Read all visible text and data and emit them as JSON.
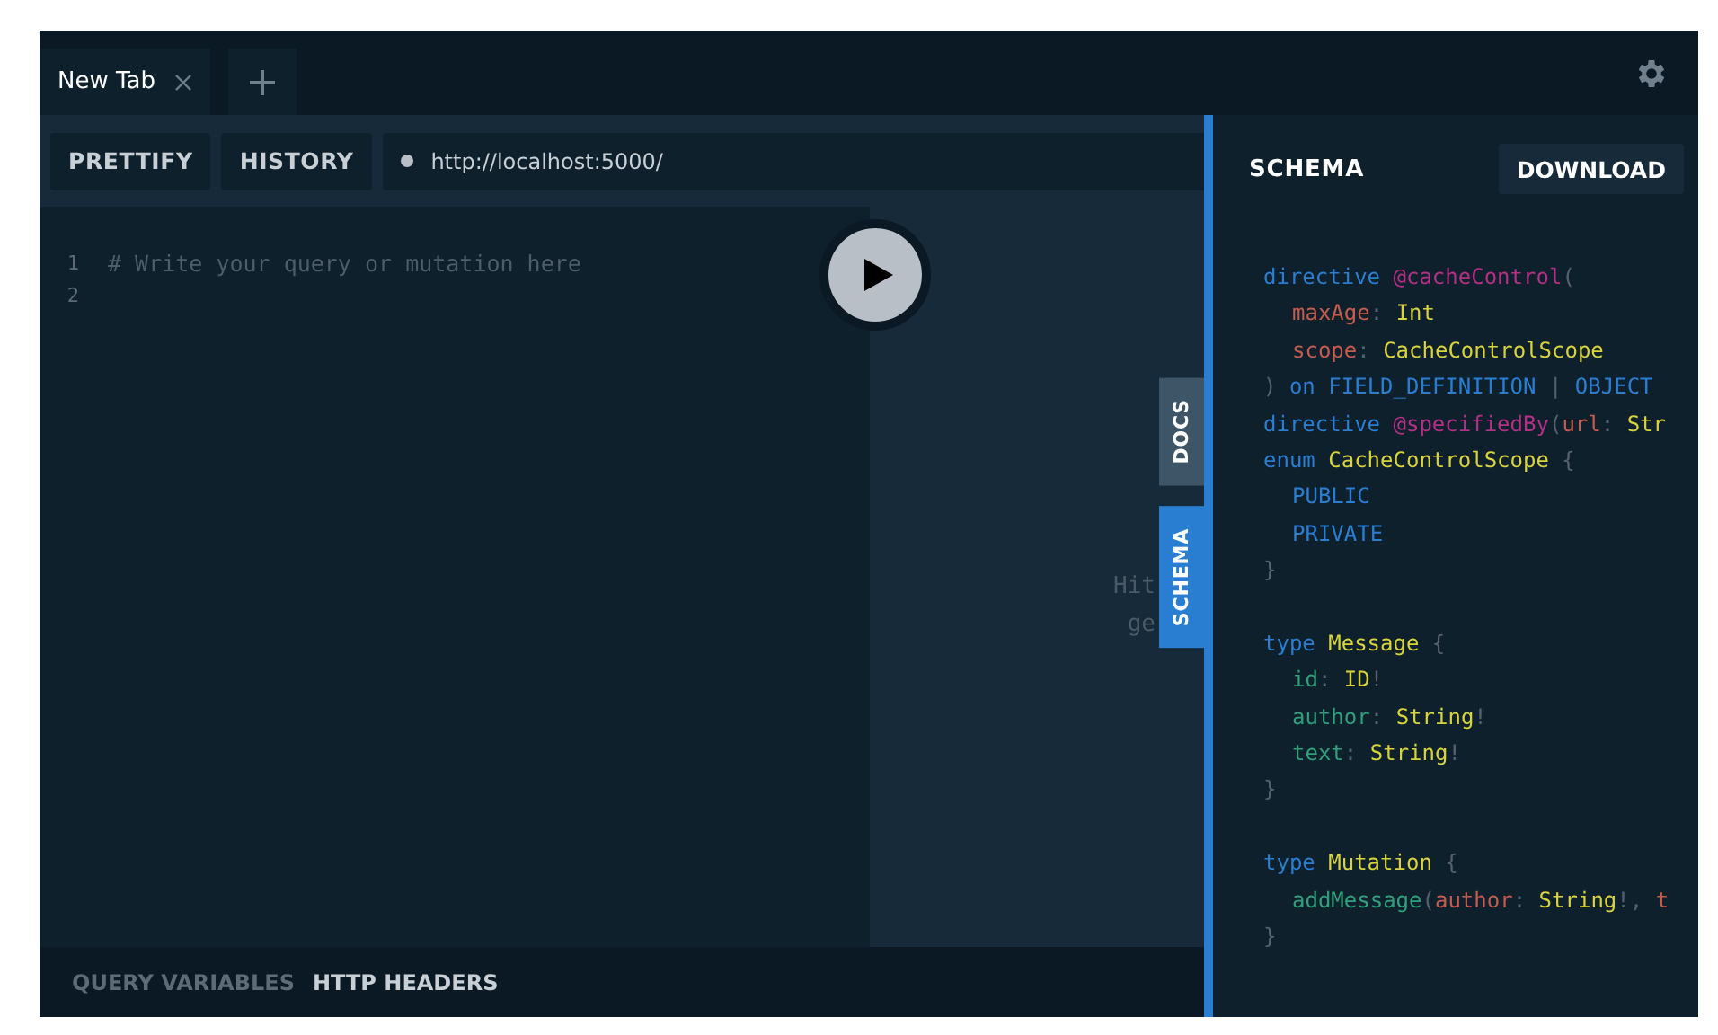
{
  "tabs": [
    {
      "title": "New Tab",
      "selected": true
    }
  ],
  "toolbar": {
    "buttons": [
      "PRETTIFY",
      "HISTORY"
    ],
    "endpoint": "http://localhost:5000/"
  },
  "editor": {
    "lines": [
      {
        "number": "1",
        "text": "# Write your query or mutation here"
      },
      {
        "number": "2"
      }
    ]
  },
  "result": {
    "hint_lines": [
      "Hit",
      "ge"
    ]
  },
  "side_tabs": [
    {
      "label": "DOCS",
      "selected": false
    },
    {
      "label": "SCHEMA",
      "selected": true
    }
  ],
  "bottom_tabs": [
    {
      "label": "QUERY VARIABLES",
      "selected": false
    },
    {
      "label": "HTTP HEADERS",
      "selected": true
    }
  ],
  "schema_panel": {
    "title": "SCHEMA",
    "download": "DOWNLOAD",
    "lines": [
      {
        "kind": "code",
        "indented": false,
        "tokens": [
          {
            "kind": "keyword",
            "text": "directive"
          },
          {
            "kind": "directive",
            "text": " @cacheControl"
          },
          {
            "kind": "punct",
            "text": "("
          }
        ]
      },
      {
        "kind": "code",
        "indented": true,
        "tokens": [
          {
            "kind": "arg",
            "text": "maxAge"
          },
          {
            "kind": "punct",
            "text": ":"
          },
          {
            "kind": "type",
            "text": " Int"
          }
        ]
      },
      {
        "kind": "code",
        "indented": true,
        "tokens": [
          {
            "kind": "arg",
            "text": "scope"
          },
          {
            "kind": "punct",
            "text": ":"
          },
          {
            "kind": "type",
            "text": " CacheControlScope"
          }
        ]
      },
      {
        "kind": "code",
        "indented": false,
        "tokens": [
          {
            "kind": "punct",
            "text": ")"
          },
          {
            "kind": "keyword",
            "text": " on"
          },
          {
            "kind": "enum",
            "text": " FIELD_DEFINITION"
          },
          {
            "kind": "punct",
            "text": " |"
          },
          {
            "kind": "enum",
            "text": " OBJECT"
          }
        ]
      },
      {
        "kind": "code",
        "indented": false,
        "tokens": [
          {
            "kind": "keyword",
            "text": "directive"
          },
          {
            "kind": "directive",
            "text": " @specifiedBy"
          },
          {
            "kind": "punct",
            "text": "("
          },
          {
            "kind": "arg",
            "text": "url"
          },
          {
            "kind": "punct",
            "text": ":"
          },
          {
            "kind": "type",
            "text": " Str"
          }
        ]
      },
      {
        "kind": "code",
        "indented": false,
        "tokens": [
          {
            "kind": "keyword",
            "text": "enum"
          },
          {
            "kind": "type",
            "text": " CacheControlScope"
          },
          {
            "kind": "punct",
            "text": " {"
          }
        ]
      },
      {
        "kind": "code",
        "indented": true,
        "tokens": [
          {
            "kind": "enum",
            "text": "PUBLIC"
          }
        ]
      },
      {
        "kind": "code",
        "indented": true,
        "tokens": [
          {
            "kind": "enum",
            "text": "PRIVATE"
          }
        ]
      },
      {
        "kind": "code",
        "indented": false,
        "tokens": [
          {
            "kind": "punct",
            "text": "}"
          }
        ]
      },
      {
        "kind": "blank"
      },
      {
        "kind": "code",
        "indented": false,
        "tokens": [
          {
            "kind": "keyword",
            "text": "type"
          },
          {
            "kind": "type",
            "text": " Message"
          },
          {
            "kind": "punct",
            "text": " {"
          }
        ]
      },
      {
        "kind": "code",
        "indented": true,
        "tokens": [
          {
            "kind": "property",
            "text": "id"
          },
          {
            "kind": "punct",
            "text": ":"
          },
          {
            "kind": "type",
            "text": " ID"
          },
          {
            "kind": "punct",
            "text": "!"
          }
        ]
      },
      {
        "kind": "code",
        "indented": true,
        "tokens": [
          {
            "kind": "property",
            "text": "author"
          },
          {
            "kind": "punct",
            "text": ":"
          },
          {
            "kind": "type",
            "text": " String"
          },
          {
            "kind": "punct",
            "text": "!"
          }
        ]
      },
      {
        "kind": "code",
        "indented": true,
        "tokens": [
          {
            "kind": "property",
            "text": "text"
          },
          {
            "kind": "punct",
            "text": ":"
          },
          {
            "kind": "type",
            "text": " String"
          },
          {
            "kind": "punct",
            "text": "!"
          }
        ]
      },
      {
        "kind": "code",
        "indented": false,
        "tokens": [
          {
            "kind": "punct",
            "text": "}"
          }
        ]
      },
      {
        "kind": "blank"
      },
      {
        "kind": "code",
        "indented": false,
        "tokens": [
          {
            "kind": "keyword",
            "text": "type"
          },
          {
            "kind": "type",
            "text": " Mutation"
          },
          {
            "kind": "punct",
            "text": " {"
          }
        ]
      },
      {
        "kind": "code",
        "indented": true,
        "tokens": [
          {
            "kind": "property",
            "text": "addMessage"
          },
          {
            "kind": "punct",
            "text": "("
          },
          {
            "kind": "arg",
            "text": "author"
          },
          {
            "kind": "punct",
            "text": ":"
          },
          {
            "kind": "type",
            "text": " String"
          },
          {
            "kind": "punct",
            "text": "!,"
          },
          {
            "kind": "arg",
            "text": " t"
          }
        ]
      },
      {
        "kind": "code",
        "indented": false,
        "tokens": [
          {
            "kind": "punct",
            "text": "}"
          }
        ]
      }
    ]
  }
}
